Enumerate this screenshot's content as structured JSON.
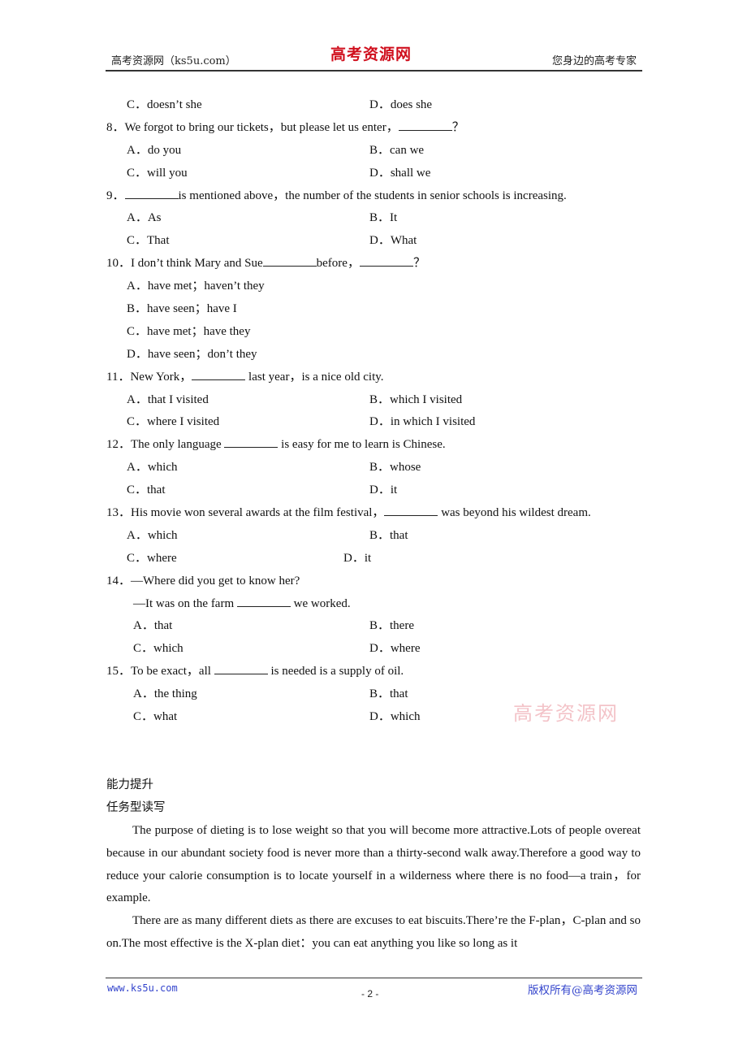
{
  "header": {
    "left": "高考资源网（ks5u.com）",
    "logo": "高考资源网",
    "right": "您身边的高考专家"
  },
  "q7_tail": {
    "options": [
      "C．doesn’t she",
      "D．does she"
    ]
  },
  "questions": [
    {
      "num": "8．",
      "stem_before": "We forgot to bring our tickets，but please let us enter，",
      "stem_after": "？",
      "options": [
        "A．do you",
        "B．can we",
        "C．will you",
        "D．shall we"
      ]
    },
    {
      "num": "9．",
      "stem_before": "",
      "stem_after": "is mentioned above，the number of the students in senior schools is increasing.",
      "options": [
        "A．As",
        "B．It",
        "C．That",
        "D．What"
      ]
    },
    {
      "num": "10．",
      "stem_before": "I don’t think Mary and Sue",
      "stem_mid": "before，",
      "stem_after": "？",
      "options": [
        "A．have met；haven’t they",
        "B．have seen；have I",
        "C．have met；have they",
        "D．have seen；don’t they"
      ]
    },
    {
      "num": "11．",
      "stem_before": "New York，",
      "stem_after": " last year，is a nice old city.",
      "options": [
        "A．that I visited",
        "B．which I visited",
        "C．where I visited",
        "D．in which I visited"
      ]
    },
    {
      "num": "12．",
      "stem_before": "The only language ",
      "stem_after": " is easy for me to learn is Chinese.",
      "options": [
        "A．which",
        "B．whose",
        "C．that",
        "D．it"
      ]
    },
    {
      "num": "13．",
      "stem_before": "His movie won several awards at the film festival，",
      "stem_after": " was beyond his wildest dream.",
      "options": [
        "A．which",
        "B．that",
        "C．where",
        "D．it"
      ]
    },
    {
      "num": "14．",
      "stem_before": "—Where did you get to know her?",
      "line2_before": "—It was on the farm ",
      "line2_after": " we worked.",
      "options": [
        "A．that",
        "B．there",
        "C．which",
        "D．where"
      ]
    },
    {
      "num": "15．",
      "stem_before": "To be exact，all ",
      "stem_after": " is needed is a supply of oil.",
      "options": [
        "A．the thing",
        "B．that",
        "C．what",
        "D．which"
      ]
    }
  ],
  "watermark": "高考资源网",
  "section": {
    "title": "能力提升",
    "subtitle": "任务型读写",
    "paragraphs": [
      "The purpose of dieting is to lose weight so that you will become more attractive.Lots of people overeat because in our abundant society food is never more than a thirty-second walk away.Therefore a good way to reduce your calorie consumption is to locate yourself in a wilderness where there is no food—a train，for example.",
      "There are as many different diets as there are excuses to eat biscuits.There’re the F-plan，C-plan and so on.The most effective is the X-plan diet：you can eat anything you like so long as it"
    ]
  },
  "footer": {
    "left": "www.ks5u.com",
    "page": "- 2 -",
    "right": "版权所有@高考资源网"
  }
}
